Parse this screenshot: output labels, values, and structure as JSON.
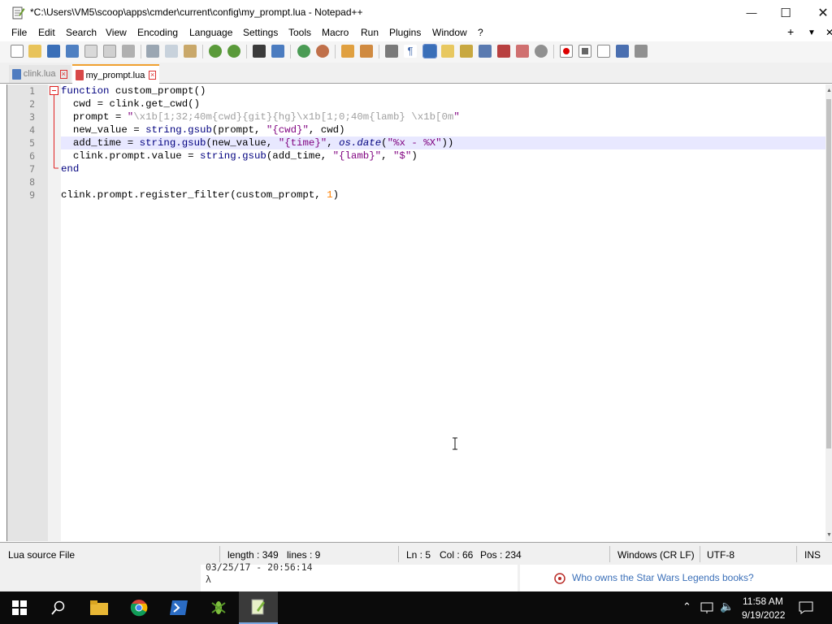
{
  "window": {
    "title": "*C:\\Users\\VM5\\scoop\\apps\\cmder\\current\\config\\my_prompt.lua - Notepad++",
    "minimize_glyph": "—",
    "maximize_glyph": "☐",
    "close_glyph": "✕"
  },
  "menu": [
    "File",
    "Edit",
    "Search",
    "View",
    "Encoding",
    "Language",
    "Settings",
    "Tools",
    "Macro",
    "Run",
    "Plugins",
    "Window",
    "?"
  ],
  "menu_right": {
    "add": "+",
    "dropdown": "▼",
    "close": "✕"
  },
  "tabs": [
    {
      "label": "clink.lua",
      "active": false
    },
    {
      "label": "my_prompt.lua",
      "active": true
    }
  ],
  "code": {
    "line_numbers": [
      "1",
      "2",
      "3",
      "4",
      "5",
      "6",
      "7",
      "8",
      "9"
    ],
    "active_line": 5,
    "lines": {
      "l1": {
        "kw": "function",
        "rest": " custom_prompt()"
      },
      "l2": {
        "text": "  cwd = clink.get_cwd()"
      },
      "l3": {
        "a": "  prompt = ",
        "q1": "\"",
        "s": "\\x1b[1;32;40m{cwd}{git}{hg}\\x1b[1;0;40m{lamb} \\x1b[0m",
        "q2": "\""
      },
      "l4": {
        "a": "  new_value = ",
        "fn": "string.gsub",
        "b": "(prompt, ",
        "s": "\"{cwd}\"",
        "c": ", cwd)"
      },
      "l5": {
        "a": "  add_time = ",
        "fn": "string.gsub",
        "b": "(new_value, ",
        "s": "\"{time}\"",
        "c": ", ",
        "fn2": "os.date",
        "d": "(",
        "s2": "\"%x - %X\"",
        "e": "))"
      },
      "l6": {
        "a": "  clink.prompt.value = ",
        "fn": "string.gsub",
        "b": "(add_time, ",
        "s": "\"{lamb}\"",
        "c": ", ",
        "s2": "\"$\"",
        "d": ")"
      },
      "l7": {
        "kw": "end"
      },
      "l9": {
        "a": "clink.prompt.register_filter(custom_prompt, ",
        "num": "1",
        "b": ")"
      }
    }
  },
  "status": {
    "filetype": "Lua source File",
    "length": "length : 349",
    "lines": "lines : 9",
    "ln": "Ln : 5",
    "col": "Col : 66",
    "pos": "Pos : 234",
    "eol": "Windows (CR LF)",
    "encoding": "UTF-8",
    "mode": "INS"
  },
  "background": {
    "console_line1": "03/25/17 - 20:56:14",
    "console_line2": "λ",
    "notification": "Who owns the Star Wars Legends books?"
  },
  "taskbar": {
    "time": "11:58 AM",
    "date": "9/19/2022"
  },
  "colors": {
    "keyword": "#00007f",
    "string": "#7f007f",
    "number": "#ff8000",
    "active_line": "#e8e8ff",
    "taskbar": "#0b0b0b"
  }
}
